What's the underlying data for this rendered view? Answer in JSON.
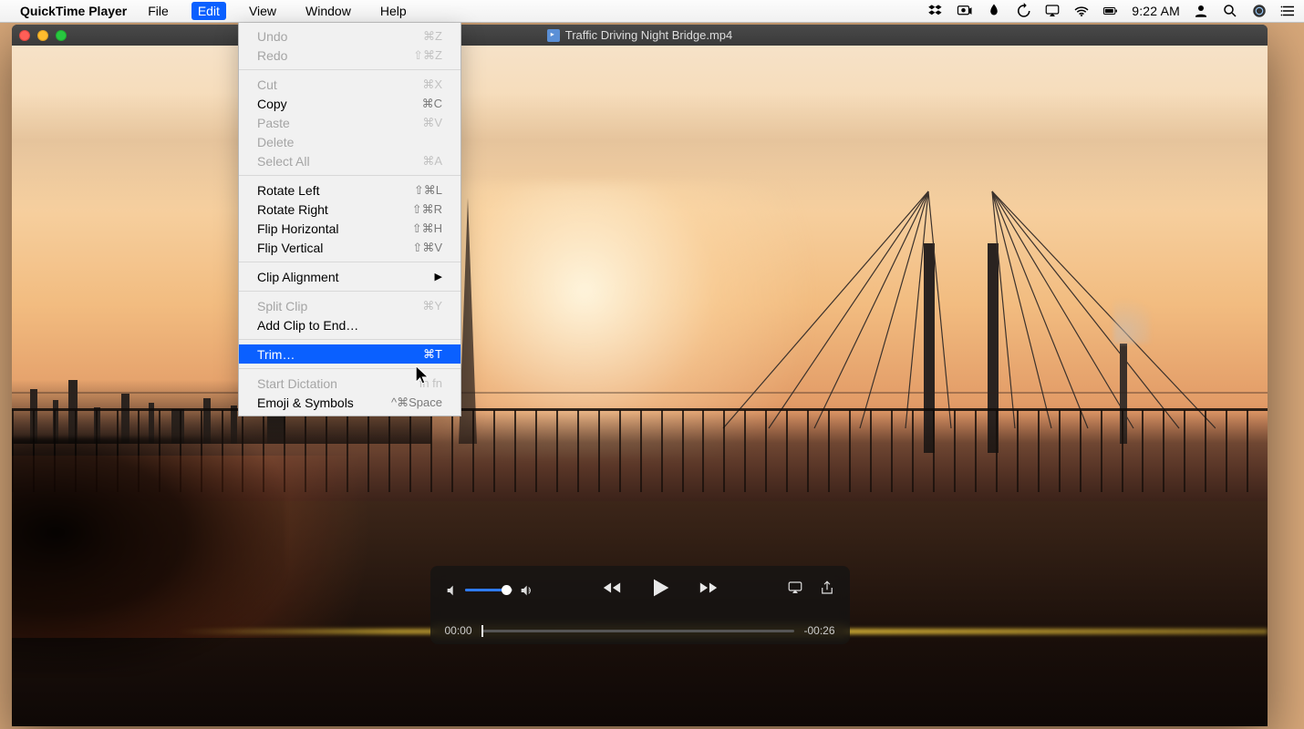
{
  "menubar": {
    "app_name": "QuickTime Player",
    "items": [
      "File",
      "Edit",
      "View",
      "Window",
      "Help"
    ],
    "active_index": 1,
    "clock": "9:22 AM"
  },
  "dropdown": {
    "groups": [
      [
        {
          "label": "Undo",
          "shortcut": "⌘Z",
          "enabled": false
        },
        {
          "label": "Redo",
          "shortcut": "⇧⌘Z",
          "enabled": false
        }
      ],
      [
        {
          "label": "Cut",
          "shortcut": "⌘X",
          "enabled": false
        },
        {
          "label": "Copy",
          "shortcut": "⌘C",
          "enabled": true
        },
        {
          "label": "Paste",
          "shortcut": "⌘V",
          "enabled": false
        },
        {
          "label": "Delete",
          "shortcut": "",
          "enabled": false
        },
        {
          "label": "Select All",
          "shortcut": "⌘A",
          "enabled": false
        }
      ],
      [
        {
          "label": "Rotate Left",
          "shortcut": "⇧⌘L",
          "enabled": true
        },
        {
          "label": "Rotate Right",
          "shortcut": "⇧⌘R",
          "enabled": true
        },
        {
          "label": "Flip Horizontal",
          "shortcut": "⇧⌘H",
          "enabled": true
        },
        {
          "label": "Flip Vertical",
          "shortcut": "⇧⌘V",
          "enabled": true
        }
      ],
      [
        {
          "label": "Clip Alignment",
          "shortcut": "",
          "enabled": true,
          "submenu": true
        }
      ],
      [
        {
          "label": "Split Clip",
          "shortcut": "⌘Y",
          "enabled": false
        },
        {
          "label": "Add Clip to End…",
          "shortcut": "",
          "enabled": true
        }
      ],
      [
        {
          "label": "Trim…",
          "shortcut": "⌘T",
          "enabled": true,
          "highlight": true
        }
      ],
      [
        {
          "label": "Start Dictation",
          "shortcut": "fn fn",
          "enabled": false
        },
        {
          "label": "Emoji & Symbols",
          "shortcut": "^⌘Space",
          "enabled": true
        }
      ]
    ]
  },
  "window": {
    "title": "Traffic Driving Night Bridge.mp4"
  },
  "player": {
    "time_elapsed": "00:00",
    "time_remaining": "-00:26",
    "volume_percent": 80
  }
}
